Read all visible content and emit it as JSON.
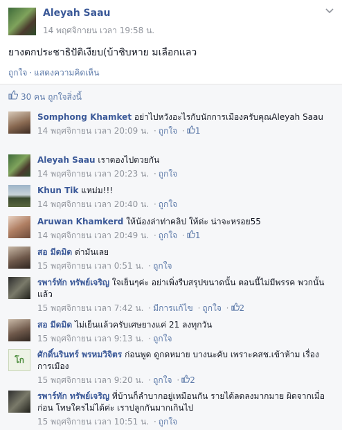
{
  "post": {
    "author": "Aleyah Saau",
    "time": "14 พฤศจิกายน เวลา 19:58 น.",
    "text": "ยางตกประชาธิปัติเงียบ(บ้าชิบหาย มเลือกแลว",
    "like_label": "ถูกใจ",
    "comment_label": "แสดงความคิดเห็น",
    "likes_summary": "30 คน ถูกใจสิ่งนี้"
  },
  "comments": [
    {
      "name": "Somphong Khamket",
      "text": "อย่าไปหวังอะไรกับนักการเมืองครับคุณAleyah Saau",
      "time": "14 พฤศจิกายน เวลา 20:09 น.",
      "like_label": "ถูกใจ",
      "likes": "1",
      "extra": ""
    },
    {
      "name": "Aleyah Saau",
      "text": "เราตองไปดวยกัน",
      "time": "14 พฤศจิกายน เวลา 20:23 น.",
      "like_label": "ถูกใจ",
      "likes": "",
      "extra": ""
    },
    {
      "name": "Khun Tik",
      "text": "แหม่ม!!!",
      "time": "14 พฤศจิกายน เวลา 20:40 น.",
      "like_label": "ถูกใจ",
      "likes": "",
      "extra": ""
    },
    {
      "name": "Aruwan Khamkerd",
      "text": "ให้น้องล่าท่าคลิป ให้ด่ะ น่าจะหรอย55",
      "time": "14 พฤศจิกายน เวลา 20:49 น.",
      "like_label": "ถูกใจ",
      "likes": "1",
      "extra": ""
    },
    {
      "name": "สอ มีดมิด",
      "text": "ด่ามันเลย",
      "time": "15 พฤศจิกายน เวลา 0:51 น.",
      "like_label": "ถูกใจ",
      "likes": "",
      "extra": ""
    },
    {
      "name": "รพาร์ทัก ทรัพย์เจริญ",
      "text": "ใจเย็นๆค่ะ อย่าเพิ่งรีบสรุปขนาดนั้น ตอนนี้ไม่มีพรรค พวกนั้นแล้ว",
      "time": "15 พฤศจิกายน เวลา 7:42 น.",
      "like_label": "ถูกใจ",
      "likes": "2",
      "extra": "มีการแก้ไข"
    },
    {
      "name": "สอ มีดมิด",
      "text": "ไม่เย็นแล้วครับเศษยางแค่ 21 ลงทุกวัน",
      "time": "15 พฤศจิกายน เวลา 9:13 น.",
      "like_label": "ถูกใจ",
      "likes": "",
      "extra": ""
    },
    {
      "name": "ศักดิ์นรินทร์ พรหมวิจิตร",
      "text": "ก่อนพูด ดูกดหมาย บางนะคับ เพราะคสช.เข้าห้าม เรื่องการเมือง",
      "time": "15 พฤศจิกายน เวลา 9:20 น.",
      "like_label": "ถูกใจ",
      "likes": "2",
      "extra": "",
      "avatar_text": "โก"
    },
    {
      "name": "รพาร์ทัก ทรัพย์เจริญ",
      "text": "ที่บ้านก็ลำบากอยู่เหมือนกัน รายได้ลดลงมากมาย ผิดจากเมื่อก่อน โทษใครไม่ได้ค่ะ เราปลูกกันมากเกินไป",
      "time": "15 พฤศจิกายน เวลา 10:51 น.",
      "like_label": "ถูกใจ",
      "likes": "",
      "extra": ""
    }
  ],
  "icons": {
    "like": "thumbs-up-icon",
    "menu": "chevron-down-icon"
  },
  "colors": {
    "link": "#3b5998",
    "muted": "#90949c",
    "bg_comments": "#f6f7f9"
  }
}
